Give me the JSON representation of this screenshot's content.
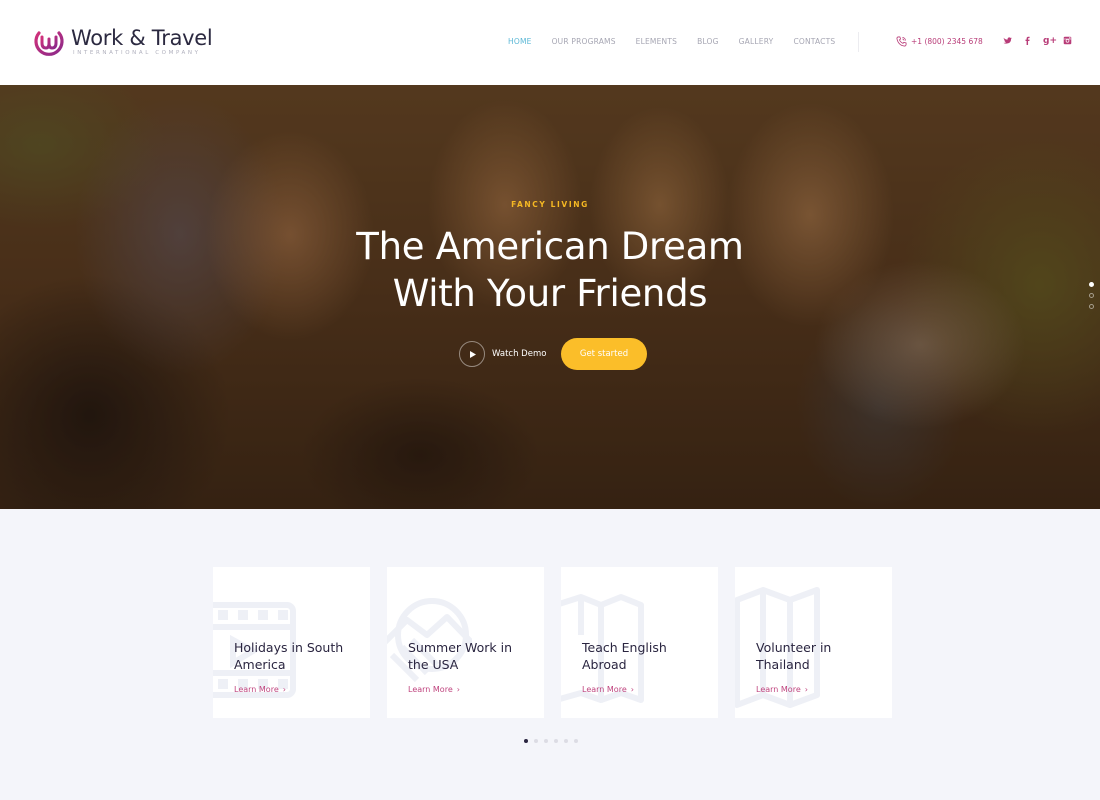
{
  "header": {
    "logo": {
      "title": "Work & Travel",
      "subtitle": "INTERNATIONAL COMPANY",
      "icon": "w-circle-logo-icon"
    },
    "nav": [
      {
        "label": "HOME",
        "active": true
      },
      {
        "label": "OUR PROGRAMS",
        "active": false
      },
      {
        "label": "ELEMENTS",
        "active": false
      },
      {
        "label": "BLOG",
        "active": false
      },
      {
        "label": "GALLERY",
        "active": false
      },
      {
        "label": "CONTACTS",
        "active": false
      }
    ],
    "phone": {
      "icon": "phone-icon",
      "number": "+1 (800) 2345 678"
    },
    "social": [
      {
        "name": "twitter",
        "icon": "twitter-icon"
      },
      {
        "name": "facebook",
        "icon": "facebook-icon"
      },
      {
        "name": "google-plus",
        "icon": "google-plus-icon",
        "glyph": "g+"
      },
      {
        "name": "instagram",
        "icon": "instagram-icon"
      }
    ]
  },
  "hero": {
    "eyebrow": "FANCY LIVING",
    "title_line1": "The American Dream",
    "title_line2": "With Your Friends",
    "watch_demo_label": "Watch Demo",
    "cta_label": "Get started",
    "slide_count": 3,
    "active_slide": 1,
    "background": "photo of four smiling girls sitting on grass"
  },
  "programs": {
    "cards": [
      {
        "title": "Holidays in South America",
        "link": "Learn More",
        "icon": "film-strip-icon"
      },
      {
        "title": "Summer Work in the USA",
        "link": "Learn More",
        "icon": "handshake-icon"
      },
      {
        "title": "Teach English Abroad",
        "link": "Learn More",
        "icon": "book-icon"
      },
      {
        "title": "Volunteer in Thailand",
        "link": "Learn More",
        "icon": "map-icon"
      }
    ],
    "chevron": "›",
    "page_count": 6,
    "active_page": 1
  },
  "colors": {
    "brand": "#b83c78",
    "accent_yellow": "#fbbe29",
    "nav_active": "#5cb8d6",
    "eyebrow": "#f5b823",
    "heading_dark": "#2a2540",
    "section_bg": "#f4f5fa"
  }
}
